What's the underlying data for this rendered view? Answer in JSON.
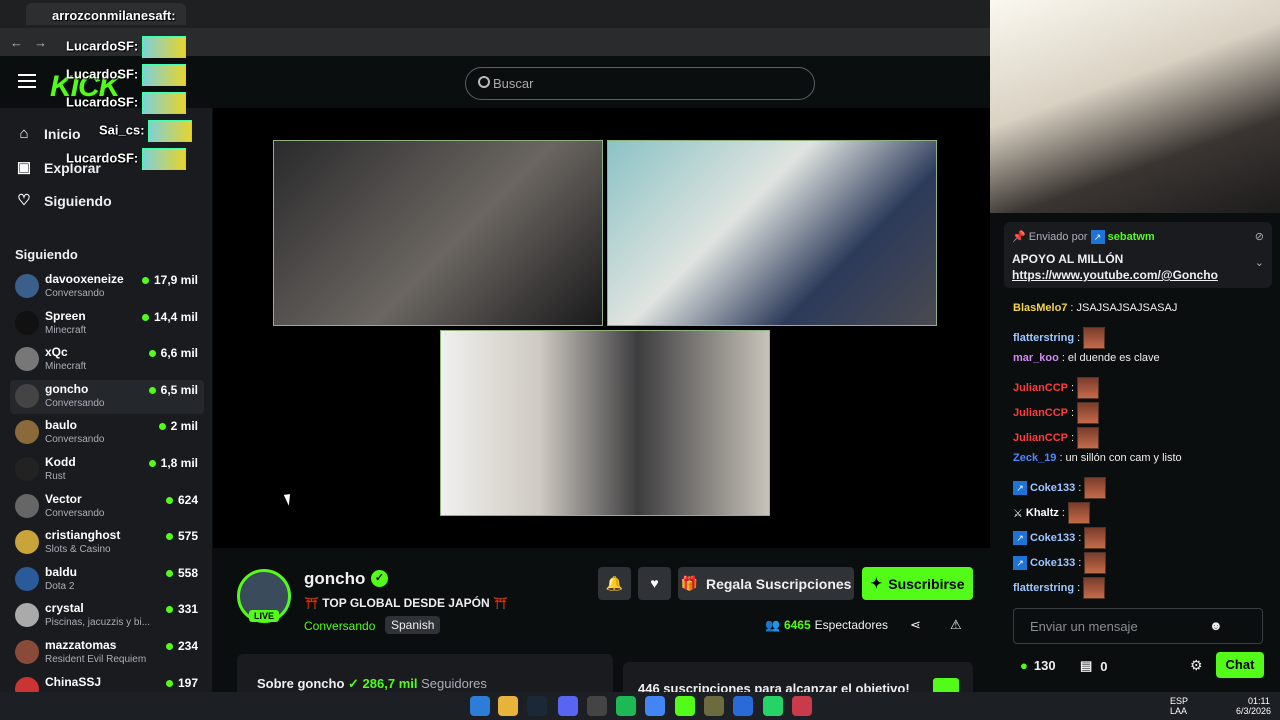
{
  "overlay": {
    "line1": "arrozconmilanesaft:",
    "line2": "LucardoSF:",
    "line3": "LucardoSF:",
    "line4": "LucardoSF:",
    "line5": "Sai_cs:",
    "line6": "LucardoSF:"
  },
  "header": {
    "logo": "KICK",
    "search_placeholder": "Buscar"
  },
  "nav": {
    "home": "Inicio",
    "explore": "Explorar",
    "following": "Siguiendo"
  },
  "following": {
    "heading": "Siguiendo",
    "channels": [
      {
        "name": "davooxeneize",
        "game": "Conversando",
        "viewers": "17,9 mil"
      },
      {
        "name": "Spreen",
        "game": "Minecraft",
        "viewers": "14,4 mil"
      },
      {
        "name": "xQc",
        "game": "Minecraft",
        "viewers": "6,6 mil"
      },
      {
        "name": "goncho",
        "game": "Conversando",
        "viewers": "6,5 mil"
      },
      {
        "name": "baulo",
        "game": "Conversando",
        "viewers": "2 mil"
      },
      {
        "name": "Kodd",
        "game": "Rust",
        "viewers": "1,8 mil"
      },
      {
        "name": "Vector",
        "game": "Conversando",
        "viewers": "624"
      },
      {
        "name": "cristianghost",
        "game": "Slots & Casino",
        "viewers": "575"
      },
      {
        "name": "baldu",
        "game": "Dota 2",
        "viewers": "558"
      },
      {
        "name": "crystal",
        "game": "Piscinas, jacuzzis y bi...",
        "viewers": "331"
      },
      {
        "name": "mazzatomas",
        "game": "Resident Evil Requiem",
        "viewers": "234"
      },
      {
        "name": "ChinaSSJ",
        "game": "",
        "viewers": "197"
      }
    ]
  },
  "stream": {
    "name": "goncho",
    "live": "LIVE",
    "title": "⛩️ TOP GLOBAL DESDE JAPÓN ⛩️",
    "category": "Conversando",
    "language": "Spanish",
    "gift_label": "Regala Suscripciones",
    "subscribe_label": "Suscribirse",
    "viewers": "6465",
    "viewers_label": "Espectadores",
    "about_prefix": "Sobre goncho",
    "followers": "286,7 mil",
    "followers_label": "Seguidores",
    "goal": "446 suscripciones para alcanzar el objetivo!"
  },
  "chat": {
    "pinned_by": "Enviado por",
    "pinned_user": "sebatwm",
    "pinned_title": "APOYO AL MILLÓN",
    "pinned_link": "https://www.youtube.com/@Goncho",
    "messages": [
      {
        "user": "BlasMelo7",
        "text": "JSAJSAJSAJSASAJ",
        "color": "#f4d24b"
      },
      {
        "user": "flatterstring",
        "text": "",
        "color": "#9ec6ff"
      },
      {
        "user": "mar_koo",
        "text": "el duende es clave",
        "color": "#d08bf0"
      },
      {
        "user": "JulianCCP",
        "text": "",
        "color": "#ff3b3b"
      },
      {
        "user": "JulianCCP",
        "text": "",
        "color": "#ff3b3b"
      },
      {
        "user": "JulianCCP",
        "text": "",
        "color": "#ff3b3b"
      },
      {
        "user": "Zeck_19",
        "text": "un sillón con cam y listo",
        "color": "#4f86ff"
      },
      {
        "user": "Coke133",
        "text": "",
        "color": "#9ec6ff"
      },
      {
        "user": "Khaltz",
        "text": "",
        "color": "#ffffff"
      },
      {
        "user": "Coke133",
        "text": "",
        "color": "#9ec6ff"
      },
      {
        "user": "Coke133",
        "text": "",
        "color": "#9ec6ff"
      },
      {
        "user": "flatterstring",
        "text": "",
        "color": "#9ec6ff"
      }
    ],
    "input_placeholder": "Enviar un mensaje",
    "points": "130",
    "drops": "0",
    "chat_button": "Chat"
  },
  "taskbar": {
    "lang1": "ESP",
    "lang2": "LAA",
    "time": "01:11",
    "date": "6/3/2026"
  },
  "colors": {
    "accent": "#53fc18",
    "bg": "#0b0e0f",
    "sidebar": "#191b1f"
  }
}
